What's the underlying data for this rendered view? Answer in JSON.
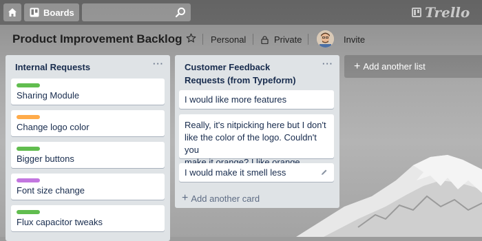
{
  "header": {
    "home_icon": "home-icon",
    "boards_label": "Boards",
    "search_placeholder": "",
    "logo_text": "Trello"
  },
  "board": {
    "title": "Product Improvement Backlog",
    "visibility_team": "Personal",
    "visibility_privacy": "Private",
    "invite_label": "Invite"
  },
  "lists": [
    {
      "title": "Internal Requests",
      "cards": [
        {
          "title": "Sharing Module",
          "label_color": "#61bd4f"
        },
        {
          "title": "Change logo color",
          "label_color": "#ffab4a"
        },
        {
          "title": "Bigger buttons",
          "label_color": "#61bd4f"
        },
        {
          "title": "Font size change",
          "label_color": "#c377e0"
        },
        {
          "title": "Flux capacitor tweaks",
          "label_color": "#61bd4f"
        }
      ]
    },
    {
      "title_line1": "Customer Feedback",
      "title_line2": "Requests (from Typeform)",
      "cards": [
        {
          "title": "I would like more features"
        },
        {
          "line1": "Really, it's nitpicking here but I don't",
          "line2": "like the color of the logo. Couldn't you",
          "line3": "make it orange? I like orange"
        },
        {
          "title": "I would make it smell less"
        }
      ],
      "add_card_label": "Add another card"
    }
  ],
  "add_list_label": "Add another list",
  "colors": {
    "list_bg": "#dfe3e6",
    "card_text": "#172b4d",
    "label_green": "#61bd4f",
    "label_orange": "#ffab4a",
    "label_purple": "#c377e0"
  }
}
